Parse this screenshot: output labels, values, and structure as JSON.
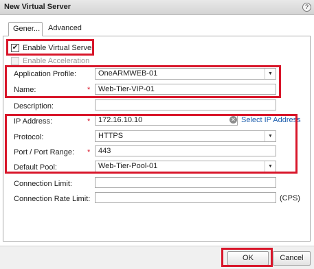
{
  "dialog": {
    "title": "New Virtual Server",
    "help_glyph": "?"
  },
  "tabs": [
    {
      "label": "Gener...",
      "active": true
    },
    {
      "label": "Advanced",
      "active": false
    }
  ],
  "form": {
    "enable_virtual_server": {
      "label": "Enable Virtual Server",
      "checked": true
    },
    "enable_acceleration": {
      "label": "Enable Acceleration",
      "checked": false,
      "disabled": true
    },
    "application_profile": {
      "label": "Application Profile:",
      "value": "OneARMWEB-01"
    },
    "name": {
      "label": "Name:",
      "value": "Web-Tier-VIP-01",
      "required": true
    },
    "description": {
      "label": "Description:",
      "value": ""
    },
    "ip_address": {
      "label": "IP Address:",
      "value": "172.16.10.10",
      "required": true,
      "link": "Select IP Address"
    },
    "protocol": {
      "label": "Protocol:",
      "value": "HTTPS"
    },
    "port_range": {
      "label": "Port / Port Range:",
      "value": "443",
      "required": true
    },
    "default_pool": {
      "label": "Default Pool:",
      "value": "Web-Tier-Pool-01"
    },
    "connection_limit": {
      "label": "Connection Limit:",
      "value": ""
    },
    "connection_rate_limit": {
      "label": "Connection Rate Limit:",
      "value": "",
      "unit": "(CPS)"
    }
  },
  "buttons": {
    "ok": "OK",
    "cancel": "Cancel"
  },
  "glyphs": {
    "required": "*",
    "check": "✔",
    "dropdown": "▼",
    "clear": "✕"
  },
  "colors": {
    "highlight": "#d8162a",
    "link": "#1f5fae",
    "required": "#d8162a"
  }
}
